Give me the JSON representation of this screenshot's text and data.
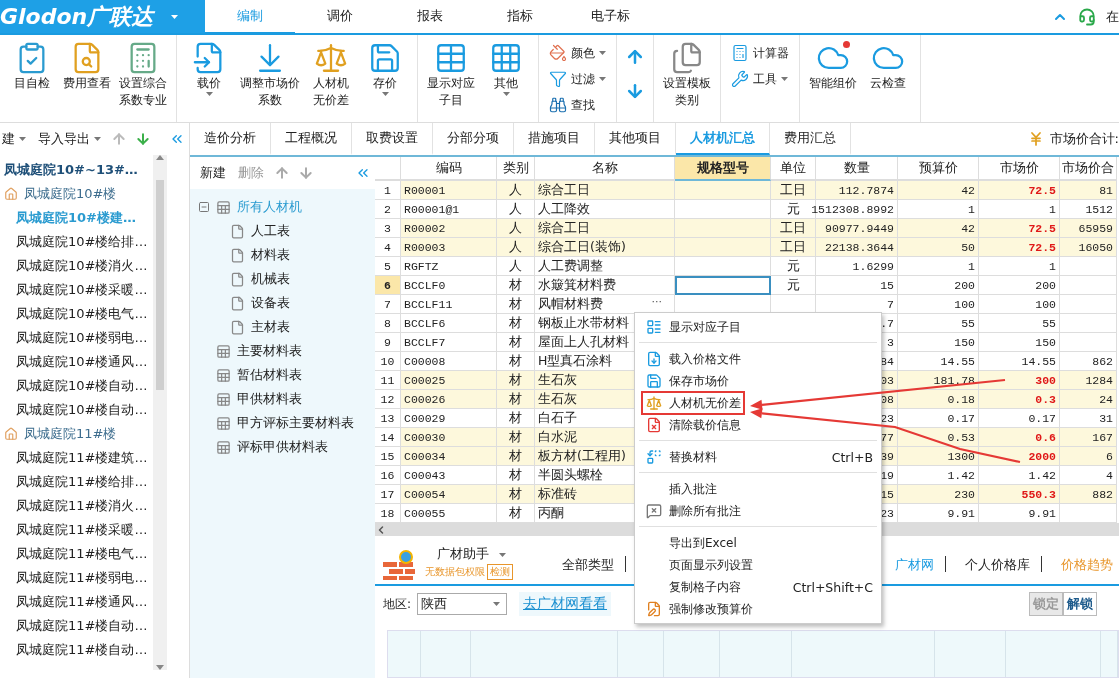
{
  "title_bar": {
    "logo": "Glodon广联达",
    "tabs": [
      {
        "label": "编制",
        "selected": true
      },
      {
        "label": "调价",
        "selected": false
      },
      {
        "label": "报表",
        "selected": false
      },
      {
        "label": "指标",
        "selected": false
      },
      {
        "label": "电子标",
        "selected": false
      }
    ],
    "online": "在"
  },
  "ribbon": {
    "groups": [
      {
        "items": [
          {
            "kind": "large",
            "lines": [
              "目自检"
            ],
            "dropdown": false,
            "badge": false
          },
          {
            "kind": "large",
            "lines": [
              "费用查看"
            ],
            "dropdown": false,
            "badge": false
          },
          {
            "kind": "large",
            "lines": [
              "设置综合",
              "系数专业"
            ],
            "dropdown": false,
            "badge": false
          }
        ]
      },
      {
        "items": [
          {
            "kind": "large",
            "lines": [
              "载价"
            ],
            "dropdown": true,
            "badge": false
          },
          {
            "kind": "large",
            "lines": [
              "调整市场价",
              "系数"
            ],
            "dropdown": false,
            "badge": false
          },
          {
            "kind": "large",
            "lines": [
              "人材机",
              "无价差"
            ],
            "dropdown": false,
            "badge": false
          },
          {
            "kind": "large",
            "lines": [
              "存价"
            ],
            "dropdown": true,
            "badge": false
          }
        ]
      },
      {
        "items": [
          {
            "kind": "large",
            "lines": [
              "显示对应",
              "子目"
            ],
            "dropdown": false,
            "badge": false
          },
          {
            "kind": "large",
            "lines": [
              "其他"
            ],
            "dropdown": true,
            "badge": false
          }
        ]
      },
      {
        "items": [
          {
            "kind": "small",
            "label": "颜色",
            "dropdown": true
          },
          {
            "kind": "small",
            "label": "过滤",
            "dropdown": true
          },
          {
            "kind": "small",
            "label": "查找",
            "dropdown": false
          }
        ]
      },
      {
        "items": [
          {
            "kind": "arrows"
          }
        ]
      },
      {
        "items": [
          {
            "kind": "large",
            "lines": [
              "设置模板",
              "类别"
            ],
            "dropdown": false,
            "badge": false
          }
        ]
      },
      {
        "items": [
          {
            "kind": "small",
            "label": "计算器",
            "dropdown": false
          },
          {
            "kind": "small",
            "label": "工具",
            "dropdown": true
          }
        ]
      },
      {
        "items": [
          {
            "kind": "large",
            "lines": [
              "智能组价"
            ],
            "dropdown": false,
            "badge": true
          },
          {
            "kind": "large",
            "lines": [
              "云检查"
            ],
            "dropdown": false,
            "badge": false
          }
        ]
      }
    ]
  },
  "nav": {
    "toolbar": [
      {
        "label": "建",
        "dropdown": true
      },
      {
        "label": "导入导出",
        "dropdown": true
      }
    ],
    "tree": [
      {
        "label": "凤城庭院10#~13#…",
        "kind": "project",
        "selected": false,
        "children": [
          {
            "label": "凤城庭院10#楼",
            "kind": "building",
            "selected": false,
            "children": [
              {
                "label": "凤城庭院10#楼建…",
                "kind": "unit",
                "selected": true
              },
              {
                "label": "凤城庭院10#楼给排…",
                "kind": "unit",
                "selected": false
              },
              {
                "label": "凤城庭院10#楼消火…",
                "kind": "unit",
                "selected": false
              },
              {
                "label": "凤城庭院10#楼采暖…",
                "kind": "unit",
                "selected": false
              },
              {
                "label": "凤城庭院10#楼电气…",
                "kind": "unit",
                "selected": false
              },
              {
                "label": "凤城庭院10#楼弱电…",
                "kind": "unit",
                "selected": false
              },
              {
                "label": "凤城庭院10#楼通风…",
                "kind": "unit",
                "selected": false
              },
              {
                "label": "凤城庭院10#楼自动…",
                "kind": "unit",
                "selected": false
              },
              {
                "label": "凤城庭院10#楼自动…",
                "kind": "unit",
                "selected": false
              }
            ]
          },
          {
            "label": "凤城庭院11#楼",
            "kind": "building",
            "selected": false,
            "children": [
              {
                "label": "凤城庭院11#楼建筑…",
                "kind": "unit",
                "selected": false
              },
              {
                "label": "凤城庭院11#楼给排…",
                "kind": "unit",
                "selected": false
              },
              {
                "label": "凤城庭院11#楼消火…",
                "kind": "unit",
                "selected": false
              },
              {
                "label": "凤城庭院11#楼采暖…",
                "kind": "unit",
                "selected": false
              },
              {
                "label": "凤城庭院11#楼电气…",
                "kind": "unit",
                "selected": false
              },
              {
                "label": "凤城庭院11#楼弱电…",
                "kind": "unit",
                "selected": false
              },
              {
                "label": "凤城庭院11#楼通风…",
                "kind": "unit",
                "selected": false
              },
              {
                "label": "凤城庭院11#楼自动…",
                "kind": "unit",
                "selected": false
              },
              {
                "label": "凤城庭院11#楼自动…",
                "kind": "unit",
                "selected": false
              }
            ]
          }
        ]
      }
    ]
  },
  "view_tabs": [
    {
      "label": "造价分析",
      "selected": false
    },
    {
      "label": "工程概况",
      "selected": false
    },
    {
      "label": "取费设置",
      "selected": false
    },
    {
      "label": "分部分项",
      "selected": false
    },
    {
      "label": "措施项目",
      "selected": false
    },
    {
      "label": "其他项目",
      "selected": false
    },
    {
      "label": "人材机汇总",
      "selected": true
    },
    {
      "label": "费用汇总",
      "selected": false
    }
  ],
  "market_total": "市场价合计:",
  "category_panel": {
    "toolbar": [
      {
        "label": "新建",
        "disabled": false
      },
      {
        "label": "删除",
        "disabled": true
      }
    ],
    "tree": [
      {
        "label": "所有人材机",
        "selected": true,
        "expanded": true,
        "children": [
          {
            "label": "人工表",
            "selected": false
          },
          {
            "label": "材料表",
            "selected": false
          },
          {
            "label": "机械表",
            "selected": false
          },
          {
            "label": "设备表",
            "selected": false
          },
          {
            "label": "主材表",
            "selected": false
          }
        ]
      },
      {
        "label": "主要材料表",
        "selected": false
      },
      {
        "label": "暂估材料表",
        "selected": false
      },
      {
        "label": "甲供材料表",
        "selected": false
      },
      {
        "label": "甲方评标主要材料表",
        "selected": false
      },
      {
        "label": "评标甲供材料表",
        "selected": false
      }
    ]
  },
  "table": {
    "columns": [
      {
        "label": "编码",
        "selected": false
      },
      {
        "label": "类别",
        "selected": false
      },
      {
        "label": "名称",
        "selected": false
      },
      {
        "label": "规格型号",
        "selected": true
      },
      {
        "label": "单位",
        "selected": false
      },
      {
        "label": "数量",
        "selected": false
      },
      {
        "label": "预算价",
        "selected": false
      },
      {
        "label": "市场价",
        "selected": false
      },
      {
        "label": "市场价合",
        "selected": false
      }
    ],
    "rows": [
      {
        "no": "1",
        "cells": [
          "R00001",
          "人",
          "综合工日",
          null,
          "工日",
          "112.7874",
          "42",
          "72.5",
          "81"
        ],
        "price_changed": true,
        "selected": false
      },
      {
        "no": "2",
        "cells": [
          "R00001@1",
          "人",
          "人工降效",
          null,
          "元",
          "1512308.8992",
          "1",
          "1",
          "1512"
        ],
        "price_changed": false,
        "selected": false
      },
      {
        "no": "3",
        "cells": [
          "R00002",
          "人",
          "综合工日",
          null,
          "工日",
          "90977.9449",
          "42",
          "72.5",
          "65959"
        ],
        "price_changed": true,
        "selected": false
      },
      {
        "no": "4",
        "cells": [
          "R00003",
          "人",
          "综合工日(装饰)",
          null,
          "工日",
          "22138.3644",
          "50",
          "72.5",
          "16050"
        ],
        "price_changed": true,
        "selected": false
      },
      {
        "no": "5",
        "cells": [
          "RGFTZ",
          "人",
          "人工费调整",
          null,
          "元",
          "1.6299",
          "1",
          "1",
          null
        ],
        "price_changed": false,
        "selected": false
      },
      {
        "no": "6",
        "cells": [
          "BCCLF0",
          "材",
          "水簸箕材料费",
          null,
          "元",
          "15",
          "200",
          "200",
          null
        ],
        "price_changed": false,
        "selected": true
      },
      {
        "no": "7",
        "cells": [
          "BCCLF11",
          "材",
          "风帽材料费",
          null,
          null,
          "7",
          "100",
          "100",
          null
        ],
        "price_changed": false,
        "selected": false,
        "more": "···"
      },
      {
        "no": "8",
        "cells": [
          "BCCLF6",
          "材",
          "钢板止水带材料",
          null,
          null,
          ".7",
          "55",
          "55",
          null
        ],
        "price_changed": false,
        "selected": false
      },
      {
        "no": "9",
        "cells": [
          "BCCLF7",
          "材",
          "屋面上人孔材料",
          null,
          null,
          "3",
          "150",
          "150",
          null
        ],
        "price_changed": false,
        "selected": false
      },
      {
        "no": "10",
        "cells": [
          "C00008",
          "材",
          "H型真石涂料",
          null,
          null,
          "84",
          "14.55",
          "14.55",
          "862"
        ],
        "price_changed": false,
        "selected": false
      },
      {
        "no": "11",
        "cells": [
          "C00025",
          "材",
          "生石灰",
          null,
          null,
          "03",
          "181.78",
          "300",
          "1284"
        ],
        "price_changed": true,
        "selected": false
      },
      {
        "no": "12",
        "cells": [
          "C00026",
          "材",
          "生石灰",
          null,
          null,
          "08",
          "0.18",
          "0.3",
          "24"
        ],
        "price_changed": true,
        "selected": false
      },
      {
        "no": "13",
        "cells": [
          "C00029",
          "材",
          "白石子",
          null,
          null,
          "23",
          "0.17",
          "0.17",
          "31"
        ],
        "price_changed": false,
        "selected": false
      },
      {
        "no": "14",
        "cells": [
          "C00030",
          "材",
          "白水泥",
          null,
          null,
          "77",
          "0.53",
          "0.6",
          "167"
        ],
        "price_changed": true,
        "selected": false
      },
      {
        "no": "15",
        "cells": [
          "C00034",
          "材",
          "板方材(工程用)",
          null,
          null,
          "39",
          "1300",
          "2000",
          "6"
        ],
        "price_changed": true,
        "selected": false
      },
      {
        "no": "16",
        "cells": [
          "C00043",
          "材",
          "半圆头螺栓",
          null,
          null,
          "19",
          "1.42",
          "1.42",
          "4"
        ],
        "price_changed": false,
        "selected": false
      },
      {
        "no": "17",
        "cells": [
          "C00054",
          "材",
          "标准砖",
          null,
          null,
          "15",
          "230",
          "550.3",
          "882"
        ],
        "price_changed": true,
        "selected": false
      },
      {
        "no": "18",
        "cells": [
          "C00055",
          "材",
          "丙酮",
          null,
          null,
          "23",
          "9.91",
          "9.91",
          null
        ],
        "price_changed": false,
        "selected": false
      }
    ]
  },
  "context_menu": {
    "groups": [
      [
        {
          "label": "显示对应子目",
          "boxed": false
        }
      ],
      [
        {
          "label": "载入价格文件",
          "boxed": false
        },
        {
          "label": "保存市场价",
          "boxed": false
        },
        {
          "label": "人材机无价差",
          "boxed": true
        },
        {
          "label": "清除载价信息",
          "boxed": false
        }
      ],
      [
        {
          "label": "替换材料",
          "shortcut": "Ctrl+B",
          "boxed": false
        }
      ],
      [
        {
          "label": "插入批注",
          "boxed": false
        },
        {
          "label": "删除所有批注",
          "boxed": false
        }
      ],
      [
        {
          "label": "导出到Excel",
          "boxed": false
        },
        {
          "label": "页面显示列设置",
          "boxed": false
        },
        {
          "label": "复制格子内容",
          "shortcut": "Ctrl+Shift+C",
          "boxed": false
        },
        {
          "label": "强制修改预算价",
          "boxed": false
        }
      ]
    ]
  },
  "helper": {
    "title": "广材助手",
    "note": "无数据包权限",
    "check_button": "检测",
    "tabs": [
      {
        "label": "全部类型",
        "kind": "tab",
        "selected": false
      },
      {
        "label": "广材网",
        "kind": "tab",
        "selected": true
      },
      {
        "label": "个人价格库",
        "kind": "tab",
        "selected": false
      },
      {
        "label": "价格趋势",
        "kind": "promo",
        "selected": false
      }
    ],
    "region_label": "地区:",
    "region": "陕西",
    "link": "去广材网看看",
    "buttons": [
      {
        "label": "锁定",
        "disabled": true
      },
      {
        "label": "解锁",
        "disabled": false
      }
    ]
  }
}
